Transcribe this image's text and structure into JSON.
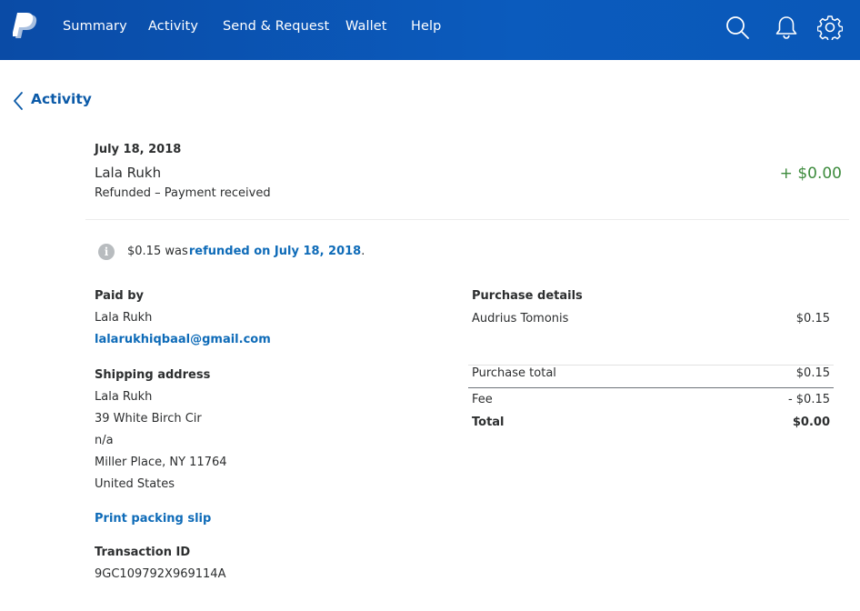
{
  "nav": {
    "items": [
      "Summary",
      "Activity",
      "Send & Request",
      "Wallet",
      "Help"
    ],
    "brand_color": "#0b5bbd",
    "icons": [
      "paypal-logo",
      "search-icon",
      "bell-icon",
      "gear-icon"
    ]
  },
  "back": {
    "label": "Activity"
  },
  "transaction": {
    "date": "July 18, 2018",
    "name": "Lala Rukh",
    "status": "Refunded – Payment received",
    "amount": "+ $0.00",
    "amount_color": "#3d8b3d"
  },
  "refund_notice": {
    "amount": "$0.15",
    "was": "was",
    "link": "refunded on July 18, 2018",
    "period": "."
  },
  "paid_by": {
    "heading": "Paid by",
    "name": "Lala Rukh",
    "email": "lalarukhiqbaal@gmail.com"
  },
  "shipping": {
    "heading": "Shipping address",
    "lines": [
      "Lala Rukh",
      "39 White Birch Cir",
      "n/a",
      "Miller Place, NY 11764",
      "United States"
    ]
  },
  "print_slip": "Print packing slip",
  "transaction_id": {
    "heading": "Transaction ID",
    "value": "9GC109792X969114A"
  },
  "purchase": {
    "heading": "Purchase details",
    "item_name": "Audrius Tomonis",
    "item_amount": "$0.15",
    "total_label": "Purchase total",
    "total_amount": "$0.15",
    "fee_label": "Fee",
    "fee_amount": "- $0.15",
    "grand_label": "Total",
    "grand_amount": "$0.00"
  }
}
